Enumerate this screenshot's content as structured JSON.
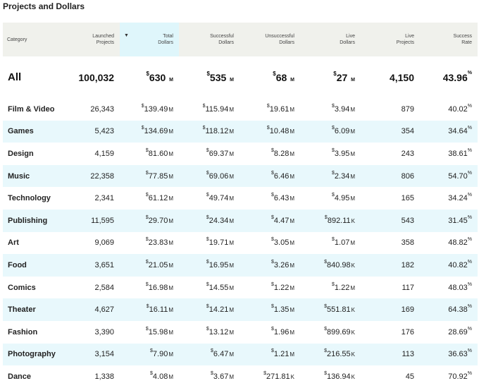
{
  "title": "Projects and Dollars",
  "headers": [
    {
      "line1": "Category",
      "line2": ""
    },
    {
      "line1": "Launched",
      "line2": "Projects"
    },
    {
      "line1": "Total",
      "line2": "Dollars"
    },
    {
      "line1": "Successful",
      "line2": "Dollars"
    },
    {
      "line1": "Unsuccessful",
      "line2": "Dollars"
    },
    {
      "line1": "Live",
      "line2": "Dollars"
    },
    {
      "line1": "Live",
      "line2": "Projects"
    },
    {
      "line1": "Success",
      "line2": "Rate"
    }
  ],
  "sort_indicator": "▼",
  "currency_symbol": "$",
  "percent_symbol": "%",
  "total_row": {
    "category": "All",
    "launched": "100,032",
    "total": {
      "amount": "630",
      "unit": "M"
    },
    "successful": {
      "amount": "535",
      "unit": "M"
    },
    "unsuccessful": {
      "amount": "68",
      "unit": "M"
    },
    "live": {
      "amount": "27",
      "unit": "M"
    },
    "live_projects": "4,150",
    "success_rate": "43.96"
  },
  "rows": [
    {
      "category": "Film & Video",
      "launched": "26,343",
      "total": {
        "amount": "139.49",
        "unit": "M"
      },
      "successful": {
        "amount": "115.94",
        "unit": "M"
      },
      "unsuccessful": {
        "amount": "19.61",
        "unit": "M"
      },
      "live": {
        "amount": "3.94",
        "unit": "M"
      },
      "live_projects": "879",
      "success_rate": "40.02"
    },
    {
      "category": "Games",
      "launched": "5,423",
      "total": {
        "amount": "134.69",
        "unit": "M"
      },
      "successful": {
        "amount": "118.12",
        "unit": "M"
      },
      "unsuccessful": {
        "amount": "10.48",
        "unit": "M"
      },
      "live": {
        "amount": "6.09",
        "unit": "M"
      },
      "live_projects": "354",
      "success_rate": "34.64"
    },
    {
      "category": "Design",
      "launched": "4,159",
      "total": {
        "amount": "81.60",
        "unit": "M"
      },
      "successful": {
        "amount": "69.37",
        "unit": "M"
      },
      "unsuccessful": {
        "amount": "8.28",
        "unit": "M"
      },
      "live": {
        "amount": "3.95",
        "unit": "M"
      },
      "live_projects": "243",
      "success_rate": "38.61"
    },
    {
      "category": "Music",
      "launched": "22,358",
      "total": {
        "amount": "77.85",
        "unit": "M"
      },
      "successful": {
        "amount": "69.06",
        "unit": "M"
      },
      "unsuccessful": {
        "amount": "6.46",
        "unit": "M"
      },
      "live": {
        "amount": "2.34",
        "unit": "M"
      },
      "live_projects": "806",
      "success_rate": "54.70"
    },
    {
      "category": "Technology",
      "launched": "2,341",
      "total": {
        "amount": "61.12",
        "unit": "M"
      },
      "successful": {
        "amount": "49.74",
        "unit": "M"
      },
      "unsuccessful": {
        "amount": "6.43",
        "unit": "M"
      },
      "live": {
        "amount": "4.95",
        "unit": "M"
      },
      "live_projects": "165",
      "success_rate": "34.24"
    },
    {
      "category": "Publishing",
      "launched": "11,595",
      "total": {
        "amount": "29.70",
        "unit": "M"
      },
      "successful": {
        "amount": "24.34",
        "unit": "M"
      },
      "unsuccessful": {
        "amount": "4.47",
        "unit": "M"
      },
      "live": {
        "amount": "892.11",
        "unit": "K"
      },
      "live_projects": "543",
      "success_rate": "31.45"
    },
    {
      "category": "Art",
      "launched": "9,069",
      "total": {
        "amount": "23.83",
        "unit": "M"
      },
      "successful": {
        "amount": "19.71",
        "unit": "M"
      },
      "unsuccessful": {
        "amount": "3.05",
        "unit": "M"
      },
      "live": {
        "amount": "1.07",
        "unit": "M"
      },
      "live_projects": "358",
      "success_rate": "48.82"
    },
    {
      "category": "Food",
      "launched": "3,651",
      "total": {
        "amount": "21.05",
        "unit": "M"
      },
      "successful": {
        "amount": "16.95",
        "unit": "M"
      },
      "unsuccessful": {
        "amount": "3.26",
        "unit": "M"
      },
      "live": {
        "amount": "840.98",
        "unit": "K"
      },
      "live_projects": "182",
      "success_rate": "40.82"
    },
    {
      "category": "Comics",
      "launched": "2,584",
      "total": {
        "amount": "16.98",
        "unit": "M"
      },
      "successful": {
        "amount": "14.55",
        "unit": "M"
      },
      "unsuccessful": {
        "amount": "1.22",
        "unit": "M"
      },
      "live": {
        "amount": "1.22",
        "unit": "M"
      },
      "live_projects": "117",
      "success_rate": "48.03"
    },
    {
      "category": "Theater",
      "launched": "4,627",
      "total": {
        "amount": "16.11",
        "unit": "M"
      },
      "successful": {
        "amount": "14.21",
        "unit": "M"
      },
      "unsuccessful": {
        "amount": "1.35",
        "unit": "M"
      },
      "live": {
        "amount": "551.81",
        "unit": "K"
      },
      "live_projects": "169",
      "success_rate": "64.38"
    },
    {
      "category": "Fashion",
      "launched": "3,390",
      "total": {
        "amount": "15.98",
        "unit": "M"
      },
      "successful": {
        "amount": "13.12",
        "unit": "M"
      },
      "unsuccessful": {
        "amount": "1.96",
        "unit": "M"
      },
      "live": {
        "amount": "899.69",
        "unit": "K"
      },
      "live_projects": "176",
      "success_rate": "28.69"
    },
    {
      "category": "Photography",
      "launched": "3,154",
      "total": {
        "amount": "7.90",
        "unit": "M"
      },
      "successful": {
        "amount": "6.47",
        "unit": "M"
      },
      "unsuccessful": {
        "amount": "1.21",
        "unit": "M"
      },
      "live": {
        "amount": "216.55",
        "unit": "K"
      },
      "live_projects": "113",
      "success_rate": "36.63"
    },
    {
      "category": "Dance",
      "launched": "1,338",
      "total": {
        "amount": "4.08",
        "unit": "M"
      },
      "successful": {
        "amount": "3.67",
        "unit": "M"
      },
      "unsuccessful": {
        "amount": "271.81",
        "unit": "K"
      },
      "live": {
        "amount": "136.94",
        "unit": "K"
      },
      "live_projects": "45",
      "success_rate": "70.92"
    }
  ]
}
